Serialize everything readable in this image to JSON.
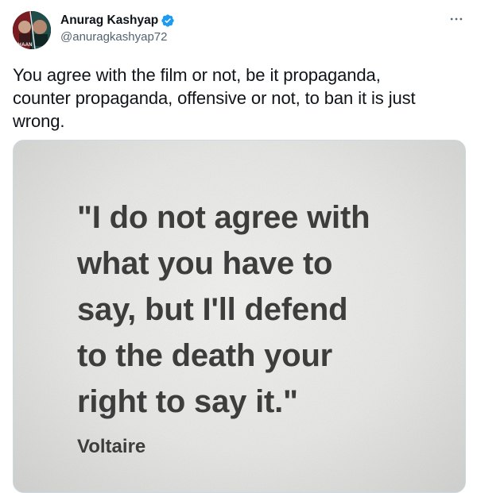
{
  "author": {
    "display_name": "Anurag Kashyap",
    "handle": "@anuragkashyap72",
    "verified": true,
    "avatar_icon": "profile-avatar",
    "avatar_caption": "KHAAN"
  },
  "tweet": {
    "text_lines": [
      "You agree with the film or not, be it propaganda,",
      "counter propaganda, offensive or not, to ban it is just",
      "wrong."
    ]
  },
  "media": {
    "quote_lines": [
      "\"I do not agree with",
      "what you have to",
      "say, but I'll defend",
      "to the death your",
      "right to say it.\""
    ],
    "attribution": "Voltaire"
  },
  "colors": {
    "verified_blue": "#1d9bf0",
    "text_primary": "#0f1419",
    "text_secondary": "#536471",
    "quote_text": "#3d3d3d"
  },
  "icons": {
    "verified": "verified-badge-icon",
    "more": "more-options-icon"
  }
}
